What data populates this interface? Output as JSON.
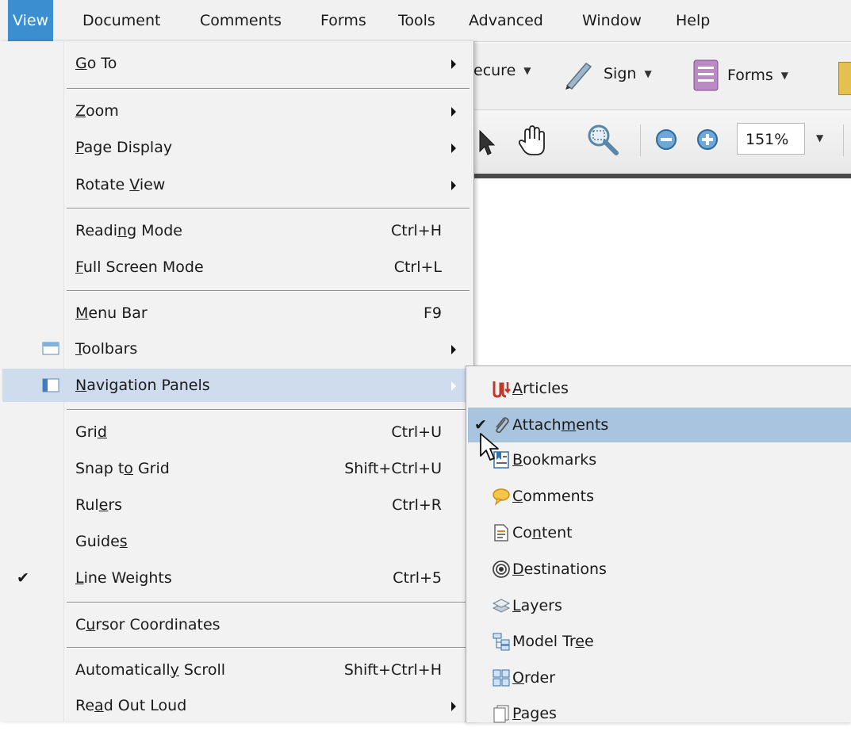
{
  "menubar": {
    "items": [
      {
        "label": "View",
        "active": true
      },
      {
        "label": "Document"
      },
      {
        "label": "Comments"
      },
      {
        "label": "Forms"
      },
      {
        "label": "Tools"
      },
      {
        "label": "Advanced"
      },
      {
        "label": "Window"
      },
      {
        "label": "Help"
      }
    ]
  },
  "toolbar": {
    "secure_label": "ecure",
    "sign_label": "Sign",
    "forms_label": "Forms",
    "zoom_value": "151%",
    "icons": [
      "secure-dropdown",
      "pen-icon",
      "forms-icon",
      "select-arrow-icon",
      "hand-icon",
      "marquee-zoom-icon",
      "zoom-out-icon",
      "zoom-in-icon"
    ]
  },
  "view_menu": {
    "items": [
      {
        "label": "Go To",
        "mnemonic": "G",
        "submenu": true
      },
      {
        "label": "Zoom",
        "mnemonic": "Z",
        "submenu": true
      },
      {
        "label": "Page Display",
        "mnemonic": "P",
        "submenu": true
      },
      {
        "label": "Rotate View",
        "mnemonic": "V",
        "submenu": true
      },
      {
        "label": "Reading Mode",
        "mnemonic": "i",
        "accel": "Ctrl+H"
      },
      {
        "label": "Full Screen Mode",
        "mnemonic": "F",
        "accel": "Ctrl+L"
      },
      {
        "label": "Menu Bar",
        "mnemonic": "M",
        "accel": "F9"
      },
      {
        "label": "Toolbars",
        "mnemonic": "T",
        "submenu": true,
        "icon": "toolbars-icon"
      },
      {
        "label": "Navigation Panels",
        "mnemonic": "N",
        "submenu": true,
        "icon": "navigation-panels-icon",
        "highlighted": true
      },
      {
        "label": "Grid",
        "mnemonic": "d",
        "accel": "Ctrl+U"
      },
      {
        "label": "Snap to Grid",
        "mnemonic": "o",
        "accel": "Shift+Ctrl+U"
      },
      {
        "label": "Rulers",
        "mnemonic": "e",
        "accel": "Ctrl+R"
      },
      {
        "label": "Guides",
        "mnemonic": "s"
      },
      {
        "label": "Line Weights",
        "mnemonic": "L",
        "accel": "Ctrl+5",
        "checked": true,
        "check_mark": "✔"
      },
      {
        "label": "Cursor Coordinates",
        "mnemonic": "u"
      },
      {
        "label": "Automatically Scroll",
        "mnemonic": "y",
        "accel": "Shift+Ctrl+H"
      },
      {
        "label": "Read Out Loud",
        "mnemonic": "a",
        "submenu": true
      }
    ]
  },
  "nav_submenu": {
    "items": [
      {
        "label": "Articles",
        "mnemonic": "A",
        "icon": "articles-icon"
      },
      {
        "label": "Attachments",
        "mnemonic": "m",
        "icon": "paperclip-icon",
        "checked": true,
        "highlighted": true,
        "check_mark": "✔"
      },
      {
        "label": "Bookmarks",
        "mnemonic": "B",
        "icon": "bookmarks-icon"
      },
      {
        "label": "Comments",
        "mnemonic": "C",
        "icon": "speech-bubble-icon"
      },
      {
        "label": "Content",
        "mnemonic": "n",
        "icon": "content-icon"
      },
      {
        "label": "Destinations",
        "mnemonic": "D",
        "icon": "destinations-icon"
      },
      {
        "label": "Layers",
        "mnemonic": "L",
        "icon": "layers-icon"
      },
      {
        "label": "Model Tree",
        "mnemonic": "e",
        "icon": "model-tree-icon"
      },
      {
        "label": "Order",
        "mnemonic": "O",
        "icon": "order-icon"
      },
      {
        "label": "Pages",
        "mnemonic": "P",
        "icon": "pages-icon"
      }
    ]
  }
}
